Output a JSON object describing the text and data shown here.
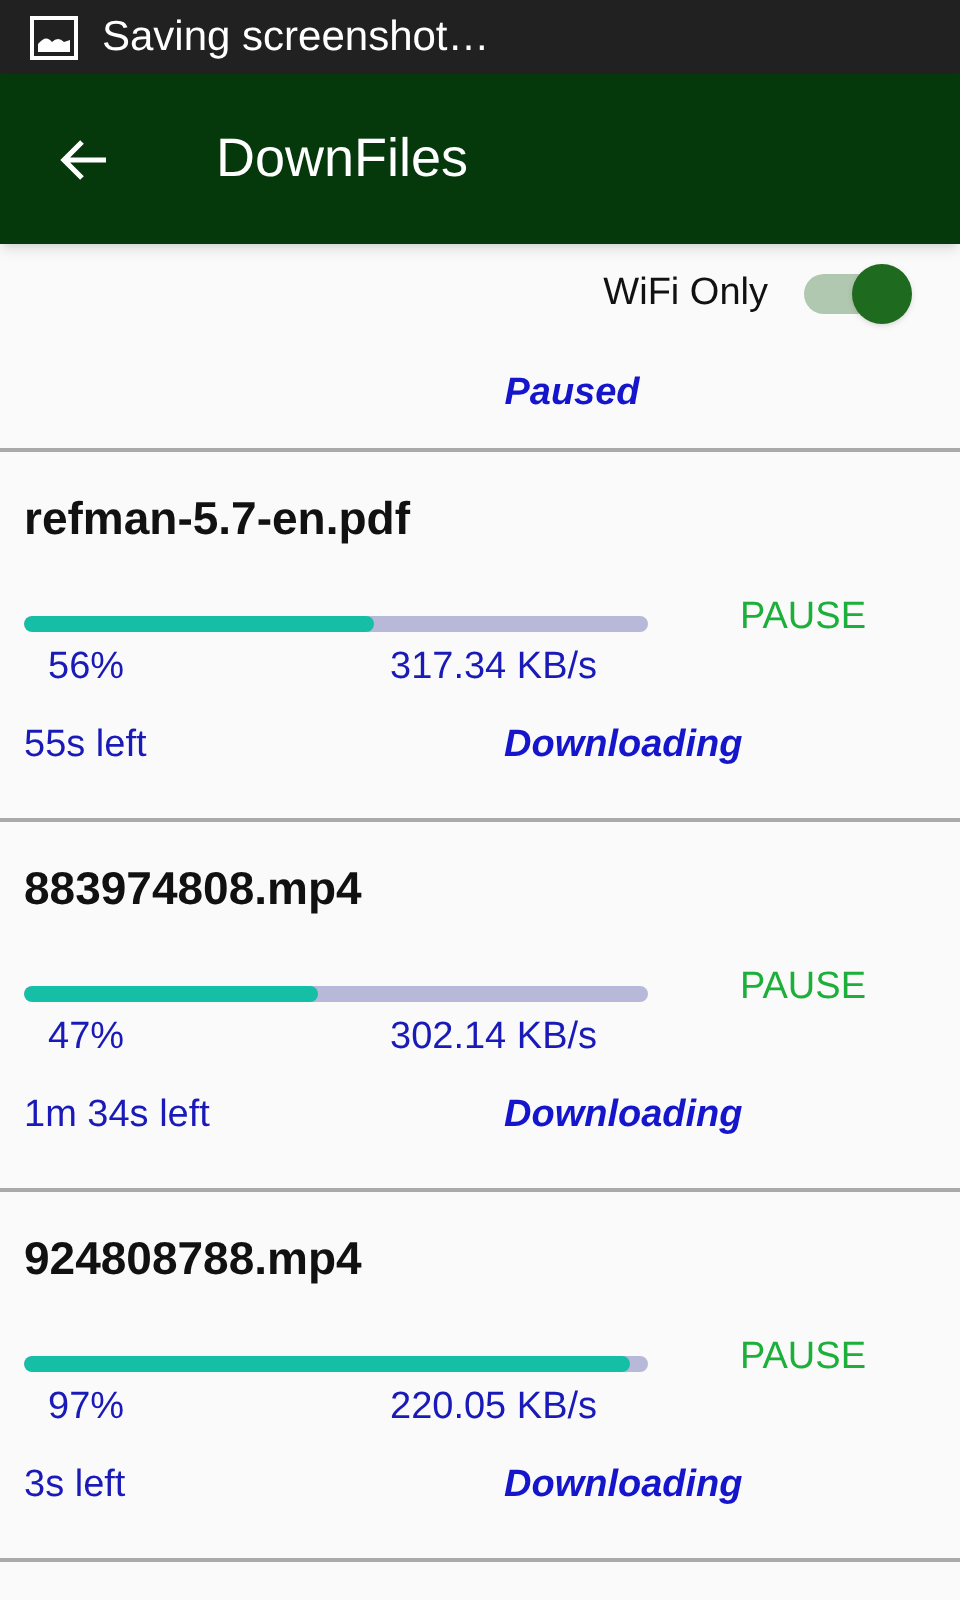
{
  "status_bar": {
    "notification": "Saving screenshot…"
  },
  "app_bar": {
    "title": "DownFiles"
  },
  "wifi_only": {
    "label": "WiFi Only",
    "on": true
  },
  "queue_status": "Paused",
  "downloads": [
    {
      "name": "refman-5.7-en.pdf",
      "level": 0.56,
      "percent": "56%",
      "speed": "317.34 KB/s",
      "remaining": "55s left",
      "state": "Downloading",
      "action": "PAUSE"
    },
    {
      "name": "883974808.mp4",
      "level": 0.47,
      "percent": "47%",
      "speed": "302.14 KB/s",
      "remaining": "1m 34s left",
      "state": "Downloading",
      "action": "PAUSE"
    },
    {
      "name": "924808788.mp4",
      "level": 0.97,
      "percent": "97%",
      "speed": "220.05 KB/s",
      "remaining": "3s left",
      "state": "Downloading",
      "action": "PAUSE"
    }
  ]
}
